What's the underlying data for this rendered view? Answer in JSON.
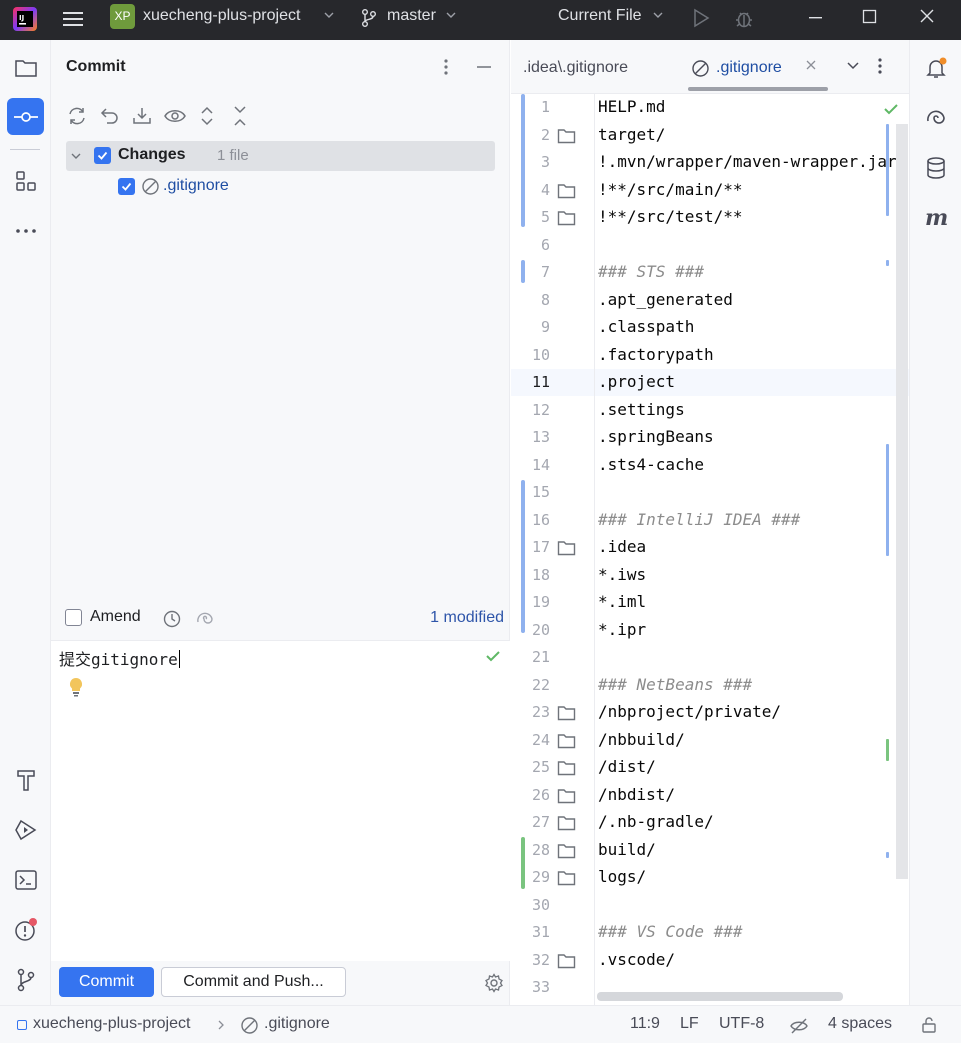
{
  "titlebar": {
    "project_badge": "XP",
    "project_name": "xuecheng-plus-project",
    "branch": "master",
    "run_config": "Current File"
  },
  "commit_panel": {
    "title": "Commit",
    "changes_label": "Changes",
    "changes_count": "1 file",
    "file_name": ".gitignore",
    "amend_label": "Amend",
    "modified_link": "1 modified",
    "commit_message": "提交gitignore",
    "commit_button": "Commit",
    "commit_push_button": "Commit and Push..."
  },
  "editor": {
    "tabs": [
      {
        "label": ".idea\\.gitignore",
        "active": false
      },
      {
        "label": ".gitignore",
        "active": true
      }
    ],
    "current_line": 11,
    "lines": [
      {
        "n": "1",
        "text": "HELP.md",
        "folder": false,
        "comment": false
      },
      {
        "n": "2",
        "text": "target/",
        "folder": true,
        "comment": false
      },
      {
        "n": "3",
        "text": "!.mvn/wrapper/maven-wrapper.jar",
        "folder": false,
        "comment": false
      },
      {
        "n": "4",
        "text": "!**/src/main/**",
        "folder": true,
        "comment": false
      },
      {
        "n": "5",
        "text": "!**/src/test/**",
        "folder": true,
        "comment": false
      },
      {
        "n": "6",
        "text": "",
        "folder": false,
        "comment": false
      },
      {
        "n": "7",
        "text": "### STS ###",
        "folder": false,
        "comment": true
      },
      {
        "n": "8",
        "text": ".apt_generated",
        "folder": false,
        "comment": false
      },
      {
        "n": "9",
        "text": ".classpath",
        "folder": false,
        "comment": false
      },
      {
        "n": "10",
        "text": ".factorypath",
        "folder": false,
        "comment": false
      },
      {
        "n": "11",
        "text": ".project",
        "folder": false,
        "comment": false
      },
      {
        "n": "12",
        "text": ".settings",
        "folder": false,
        "comment": false
      },
      {
        "n": "13",
        "text": ".springBeans",
        "folder": false,
        "comment": false
      },
      {
        "n": "14",
        "text": ".sts4-cache",
        "folder": false,
        "comment": false
      },
      {
        "n": "15",
        "text": "",
        "folder": false,
        "comment": false
      },
      {
        "n": "16",
        "text": "### IntelliJ IDEA ###",
        "folder": false,
        "comment": true
      },
      {
        "n": "17",
        "text": ".idea",
        "folder": true,
        "comment": false
      },
      {
        "n": "18",
        "text": "*.iws",
        "folder": false,
        "comment": false
      },
      {
        "n": "19",
        "text": "*.iml",
        "folder": false,
        "comment": false
      },
      {
        "n": "20",
        "text": "*.ipr",
        "folder": false,
        "comment": false
      },
      {
        "n": "21",
        "text": "",
        "folder": false,
        "comment": false
      },
      {
        "n": "22",
        "text": "### NetBeans ###",
        "folder": false,
        "comment": true
      },
      {
        "n": "23",
        "text": "/nbproject/private/",
        "folder": true,
        "comment": false
      },
      {
        "n": "24",
        "text": "/nbbuild/",
        "folder": true,
        "comment": false
      },
      {
        "n": "25",
        "text": "/dist/",
        "folder": true,
        "comment": false
      },
      {
        "n": "26",
        "text": "/nbdist/",
        "folder": true,
        "comment": false
      },
      {
        "n": "27",
        "text": "/.nb-gradle/",
        "folder": true,
        "comment": false
      },
      {
        "n": "28",
        "text": "build/",
        "folder": true,
        "comment": false
      },
      {
        "n": "29",
        "text": "logs/",
        "folder": true,
        "comment": false
      },
      {
        "n": "30",
        "text": "",
        "folder": false,
        "comment": false
      },
      {
        "n": "31",
        "text": "### VS Code ###",
        "folder": false,
        "comment": true
      },
      {
        "n": "32",
        "text": ".vscode/",
        "folder": true,
        "comment": false
      },
      {
        "n": "33",
        "text": "",
        "folder": false,
        "comment": false
      }
    ]
  },
  "statusbar": {
    "project": "xuecheng-plus-project",
    "file": ".gitignore",
    "position": "11:9",
    "line_ending": "LF",
    "encoding": "UTF-8",
    "indent": "4 spaces"
  },
  "colors": {
    "accent": "#3574f0",
    "vcs_modified": "#8fb1ee",
    "vcs_added": "#7ac47f",
    "check_green": "#5fb865"
  },
  "icons": {
    "left_strip": [
      "folder-icon",
      "commit-icon",
      "structure-icon",
      "more-icon",
      "build-icon",
      "services-icon",
      "terminal-icon",
      "problems-icon",
      "git-icon"
    ],
    "right_strip": [
      "notifications-icon",
      "ai-assistant-icon",
      "database-icon",
      "maven-icon"
    ]
  }
}
